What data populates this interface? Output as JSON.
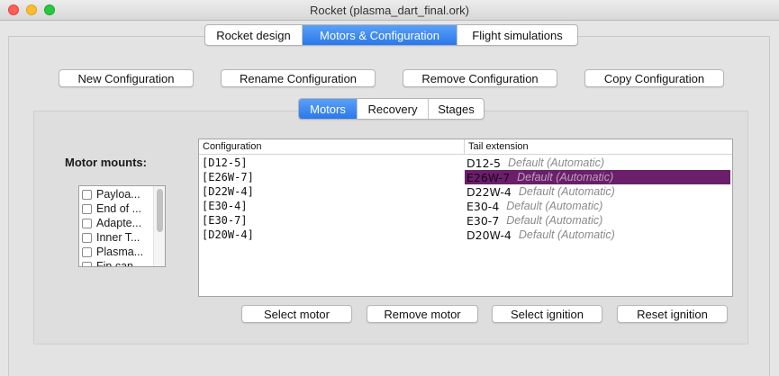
{
  "window": {
    "title": "Rocket (plasma_dart_final.ork)"
  },
  "main_tabs": [
    {
      "label": "Rocket design",
      "active": false
    },
    {
      "label": "Motors & Configuration",
      "active": true
    },
    {
      "label": "Flight simulations",
      "active": false
    }
  ],
  "config_buttons": {
    "new": "New Configuration",
    "rename": "Rename Configuration",
    "remove": "Remove Configuration",
    "copy": "Copy Configuration"
  },
  "sub_tabs": [
    {
      "label": "Motors",
      "active": true
    },
    {
      "label": "Recovery",
      "active": false
    },
    {
      "label": "Stages",
      "active": false
    }
  ],
  "motor_mounts": {
    "label": "Motor mounts:",
    "items": [
      "Payloa...",
      "End of ...",
      "Adapte...",
      "Inner T...",
      "Plasma...",
      "Fin can..."
    ]
  },
  "table": {
    "headers": [
      "Configuration",
      "Tail extension"
    ],
    "rows": [
      {
        "config": "[D12-5]",
        "motor": "D12-5",
        "default": "Default (Automatic)",
        "selected": false
      },
      {
        "config": "[E26W-7]",
        "motor": "E26W-7",
        "default": "Default (Automatic)",
        "selected": true
      },
      {
        "config": "[D22W-4]",
        "motor": "D22W-4",
        "default": "Default (Automatic)",
        "selected": false
      },
      {
        "config": "[E30-4]",
        "motor": "E30-4",
        "default": "Default (Automatic)",
        "selected": false
      },
      {
        "config": "[E30-7]",
        "motor": "E30-7",
        "default": "Default (Automatic)",
        "selected": false
      },
      {
        "config": "[D20W-4]",
        "motor": "D20W-4",
        "default": "Default (Automatic)",
        "selected": false
      }
    ]
  },
  "motor_buttons": {
    "select_motor": "Select motor",
    "remove_motor": "Remove motor",
    "select_ignition": "Select ignition",
    "reset_ignition": "Reset ignition"
  },
  "colors": {
    "accent": "#2a78ec",
    "selection": "#6b1f6b"
  }
}
